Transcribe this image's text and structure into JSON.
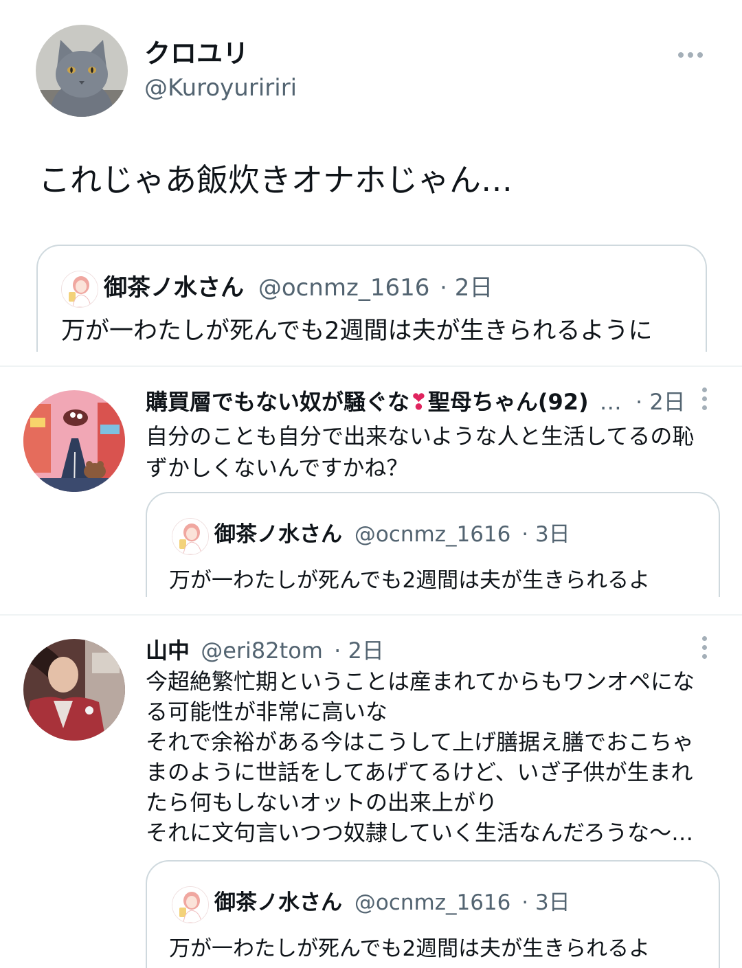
{
  "main_tweet": {
    "display_name": "クロユリ",
    "handle": "@Kuroyuririri",
    "text": "これじゃあ飯炊きオナホじゃん…",
    "quoted": {
      "display_name": "御茶ノ水さん",
      "handle": "@ocnmz_1616",
      "time": "· 2日",
      "text": "万が一わたしが死んでも2週間は夫が生きられるように"
    }
  },
  "replies": [
    {
      "display_name": "購買層でもない奴が騒ぐな",
      "display_name_emoji": "❣",
      "display_name_rest": "聖母ちゃん(92)",
      "ellipsis": "…",
      "time": "· 2日",
      "text_lines": [
        "自分のことも自分で出来ないような人と生活してるの恥",
        "ずかしくないんですかね？"
      ],
      "quoted": {
        "display_name": "御茶ノ水さん",
        "handle": "@ocnmz_1616",
        "time": "· 3日",
        "text": "万が一わたしが死んでも2週間は夫が生きられるよ"
      }
    },
    {
      "display_name": "山中",
      "handle": "@eri82tom",
      "time": "· 2日",
      "text_lines": [
        "今超絶繁忙期ということは産まれてからもワンオペにな",
        "る可能性が非常に高いな",
        "それで余裕がある今はこうして上げ膳据え膳でおこちゃ",
        "まのように世話をしてあげてるけど、いざ子供が生まれ",
        "たら何もしないオットの出来上がり",
        "それに文句言いつつ奴隷していく生活なんだろうな〜…"
      ],
      "quoted": {
        "display_name": "御茶ノ水さん",
        "handle": "@ocnmz_1616",
        "time": "· 3日",
        "text": "万が一わたしが死んでも2週間は夫が生きられるよ"
      }
    }
  ],
  "icons": {
    "more_horizontal": "more-horizontal-icon",
    "more_vertical": "more-vertical-icon"
  },
  "colors": {
    "text_primary": "#0f1419",
    "text_secondary": "#536471",
    "border": "#cfd9de",
    "separator": "#eff3f4",
    "heart_emoji": "#e0245e"
  }
}
